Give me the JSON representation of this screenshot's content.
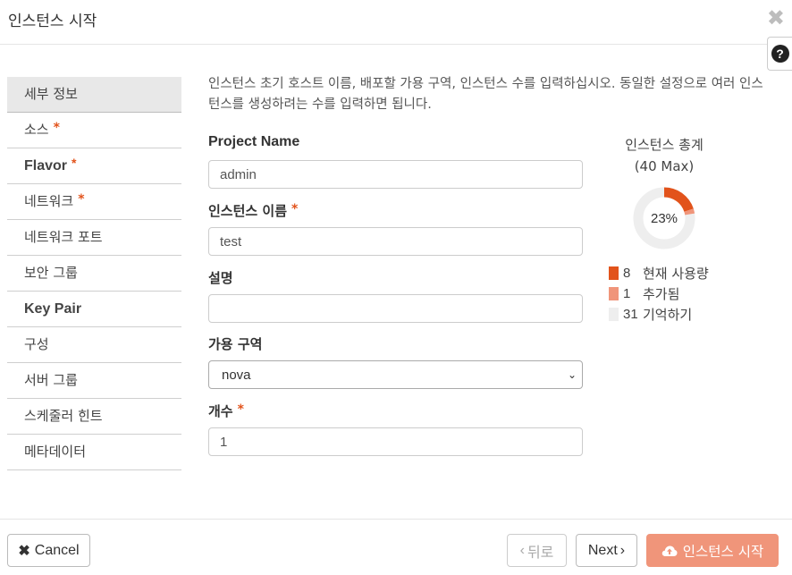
{
  "header": {
    "title": "인스턴스 시작",
    "close_icon": "close-icon",
    "help_glyph": "?"
  },
  "sidebar": {
    "items": [
      {
        "label": "세부 정보",
        "required": false,
        "active": true
      },
      {
        "label": "소스",
        "required": true,
        "active": false
      },
      {
        "label": "Flavor",
        "required": true,
        "active": false
      },
      {
        "label": "네트워크",
        "required": true,
        "active": false
      },
      {
        "label": "네트워크 포트",
        "required": false,
        "active": false
      },
      {
        "label": "보안 그룹",
        "required": false,
        "active": false
      },
      {
        "label": "Key Pair",
        "required": false,
        "active": false
      },
      {
        "label": "구성",
        "required": false,
        "active": false
      },
      {
        "label": "서버 그룹",
        "required": false,
        "active": false
      },
      {
        "label": "스케줄러 힌트",
        "required": false,
        "active": false
      },
      {
        "label": "메타데이터",
        "required": false,
        "active": false
      }
    ],
    "required_mark": "*"
  },
  "main": {
    "help_text": "인스턴스 초기 호스트 이름, 배포할 가용 구역, 인스턴스 수를 입력하십시오. 동일한 설정으로 여러 인스턴스를 생성하려는 수를 입력하면 됩니다.",
    "fields": {
      "project_name": {
        "label": "Project Name",
        "value": "admin"
      },
      "instance_name": {
        "label": "인스턴스 이름",
        "value": "test",
        "required": true
      },
      "description": {
        "label": "설명",
        "value": ""
      },
      "availability_zone": {
        "label": "가용 구역",
        "selected": "nova"
      },
      "count": {
        "label": "개수",
        "value": "1",
        "required": true
      }
    }
  },
  "quota": {
    "title": "인스턴스 총계",
    "subtitle": "(40 Max)",
    "percent_label": "23%",
    "legend": [
      {
        "value": "8",
        "label": "현재 사용량",
        "color": "#e2531b"
      },
      {
        "value": "1",
        "label": "추가됨",
        "color": "#f0957a"
      },
      {
        "value": "31",
        "label": "기억하기",
        "color": "#eeeeee"
      }
    ],
    "used_fraction": 0.2,
    "added_fraction": 0.025
  },
  "footer": {
    "cancel_label": "Cancel",
    "cancel_icon": "✖",
    "back_label": "뒤로",
    "back_icon": "‹",
    "next_label": "Next",
    "next_icon": "›",
    "launch_label": "인스턴스 시작",
    "launch_icon": "cloud-upload-icon"
  },
  "colors": {
    "accent": "#e2531b",
    "accent_light": "#f0957a",
    "active_nav_bg": "#e8e8e8"
  }
}
